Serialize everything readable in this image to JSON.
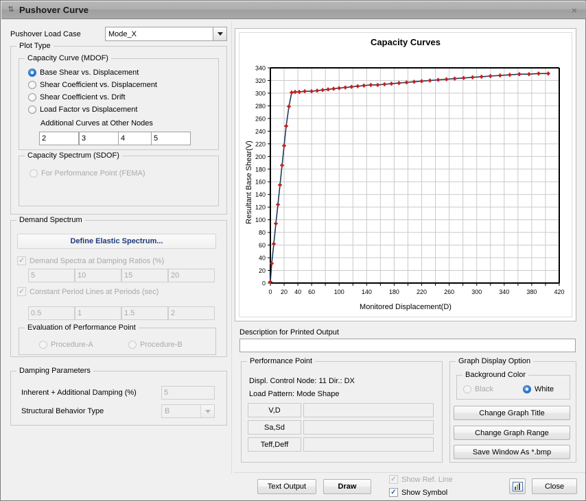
{
  "window": {
    "title": "Pushover Curve",
    "close_glyph": "×",
    "sys_glyph": "⇅"
  },
  "load_case": {
    "label": "Pushover Load Case",
    "value": "Mode_X"
  },
  "plot_type": {
    "legend": "Plot Type",
    "capacity_curve": {
      "legend": "Capacity Curve (MDOF)",
      "options": [
        {
          "label": "Base Shear vs. Displacement",
          "checked": true,
          "enabled": true
        },
        {
          "label": "Shear Coefficient vs. Displacement",
          "checked": false,
          "enabled": true
        },
        {
          "label": "Shear Coefficient vs. Drift",
          "checked": false,
          "enabled": true
        },
        {
          "label": "Load Factor vs Displacement",
          "checked": false,
          "enabled": true
        }
      ],
      "additional_curves_label": "Additional Curves at Other Nodes",
      "node_values": [
        "2",
        "3",
        "4",
        "5"
      ]
    },
    "capacity_spectrum": {
      "legend": "Capacity Spectrum (SDOF)",
      "option_label": "For Performance Point (FEMA)",
      "checked": false
    }
  },
  "demand_spectrum": {
    "legend": "Demand Spectrum",
    "define_button": "Define Elastic Spectrum...",
    "damping_ratios_label": "Demand Spectra at Damping Ratios (%)",
    "damping_ratios": [
      "5",
      "10",
      "15",
      "20"
    ],
    "period_lines_label": "Constant Period Lines at Periods (sec)",
    "periods": [
      "0.5",
      "1",
      "1.5",
      "2"
    ],
    "evaluation": {
      "legend": "Evaluation of Performance Point",
      "options": [
        "Procedure-A",
        "Procedure-B"
      ]
    }
  },
  "damping_parameters": {
    "legend": "Damping Parameters",
    "inherent_label": "Inherent + Additional Damping (%)",
    "inherent_value": "5",
    "behavior_label": "Structural Behavior Type",
    "behavior_value": "B"
  },
  "description": {
    "label": "Description for Printed Output",
    "value": "",
    "placeholder": ""
  },
  "performance_point": {
    "legend": "Performance Point",
    "control_node_line": "Displ. Control Node: 11  Dir.: DX",
    "load_pattern_line": "Load Pattern: Mode Shape",
    "rows": [
      {
        "name": "V,D",
        "value": ""
      },
      {
        "name": "Sa,Sd",
        "value": ""
      },
      {
        "name": "Teff,Deff",
        "value": ""
      }
    ]
  },
  "graph_display": {
    "legend": "Graph Display Option",
    "background_legend": "Background Color",
    "background_options": [
      {
        "label": "Black",
        "checked": false
      },
      {
        "label": "White",
        "checked": true
      }
    ],
    "buttons": [
      "Change Graph Title",
      "Change Graph Range",
      "Save Window As *.bmp"
    ]
  },
  "footer": {
    "text_output": "Text Output",
    "draw": "Draw",
    "show_ref_line": {
      "label": "Show Ref. Line",
      "checked": true,
      "enabled": false
    },
    "show_symbol": {
      "label": "Show Symbol",
      "checked": true,
      "enabled": true
    },
    "chart_icon": "chart-icon",
    "close": "Close"
  },
  "colors": {
    "accent": "#1f6fd0",
    "line": "#1f3a5f",
    "marker": "#c02020",
    "grid": "#c9c9c9",
    "axis": "#000000",
    "panel": "#f0f0f0"
  },
  "chart_data": {
    "type": "line",
    "title": "Capacity Curves",
    "xlabel": "Monitored Displacement(D)",
    "ylabel": "Resultant Base Shear(V)",
    "xlim": [
      0,
      420
    ],
    "ylim": [
      0,
      340
    ],
    "xticks": [
      0,
      20,
      40,
      60,
      100,
      140,
      180,
      220,
      260,
      300,
      340,
      380,
      420
    ],
    "xticks_all": [
      0,
      20,
      40,
      60,
      80,
      100,
      120,
      140,
      160,
      180,
      200,
      220,
      240,
      260,
      280,
      300,
      320,
      340,
      360,
      380,
      400,
      420
    ],
    "yticks": [
      0,
      20,
      40,
      60,
      80,
      100,
      120,
      140,
      160,
      180,
      200,
      220,
      240,
      260,
      280,
      300,
      320,
      340
    ],
    "grid": true,
    "legend": "none",
    "series": [
      {
        "name": "Capacity Curve",
        "marker": "diamond",
        "marker_color": "#c02020",
        "line_color": "#1f3a5f",
        "x": [
          0,
          2,
          5,
          8,
          11,
          14,
          17,
          20,
          23,
          27,
          31,
          36,
          42,
          50,
          60,
          68,
          76,
          84,
          92,
          100,
          109,
          118,
          127,
          136,
          146,
          156,
          166,
          176,
          187,
          198,
          209,
          220,
          232,
          244,
          256,
          268,
          281,
          294,
          307,
          320,
          334,
          348,
          362,
          376,
          390,
          404
        ],
        "y": [
          2,
          31,
          62,
          94,
          124,
          155,
          186,
          217,
          248,
          279,
          301,
          302,
          302,
          303,
          303,
          304,
          305,
          306,
          307,
          308,
          309,
          310,
          311,
          312,
          313,
          313,
          314,
          315,
          316,
          317,
          318,
          319,
          320,
          321,
          322,
          323,
          324,
          325,
          326,
          327,
          328,
          329,
          330,
          330,
          331,
          331
        ]
      }
    ]
  }
}
